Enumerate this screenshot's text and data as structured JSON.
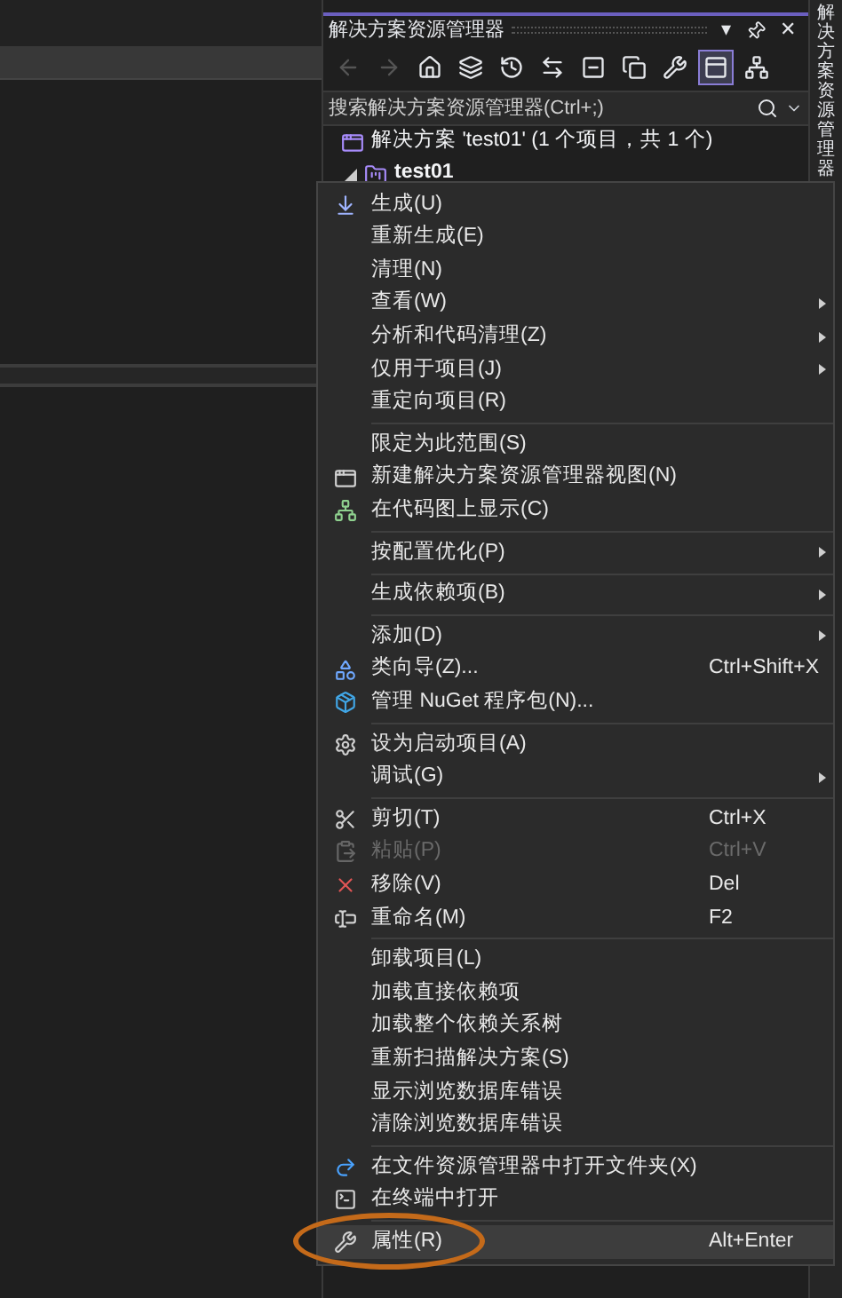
{
  "solution_explorer": {
    "title": "解决方案资源管理器",
    "title_buttons": [
      {
        "kind": "dropdown",
        "label": "▾"
      },
      {
        "kind": "pin"
      },
      {
        "kind": "close",
        "label": "✕"
      }
    ],
    "side_tab": "解决方案资源管理器",
    "toolbar": [
      {
        "kind": "back",
        "disabled": true,
        "selected": false
      },
      {
        "kind": "forward",
        "disabled": true,
        "selected": false
      },
      {
        "kind": "home",
        "disabled": false,
        "selected": false
      },
      {
        "kind": "switch-view",
        "disabled": false,
        "selected": false
      },
      {
        "kind": "history",
        "disabled": false,
        "selected": false
      },
      {
        "kind": "sync",
        "disabled": false,
        "selected": false
      },
      {
        "kind": "collapse",
        "disabled": false,
        "selected": false
      },
      {
        "kind": "copy",
        "disabled": false,
        "selected": false
      },
      {
        "kind": "properties",
        "disabled": false,
        "selected": false
      },
      {
        "kind": "preview",
        "disabled": false,
        "selected": true
      },
      {
        "kind": "diagram",
        "disabled": false,
        "selected": false
      }
    ],
    "search": {
      "placeholder": "搜索解决方案资源管理器(Ctrl+;)"
    },
    "tree": [
      {
        "label": "解决方案 'test01' (1 个项目，共 1 个)",
        "kind": "solution"
      },
      {
        "label": "test01",
        "kind": "project",
        "expanded": true
      }
    ]
  },
  "context_menu": {
    "groups": [
      {
        "items": [
          {
            "label": "生成(U)",
            "kind": "build",
            "submenu": false,
            "disabled": false,
            "highlighted": false,
            "circled": false
          },
          {
            "label": "重新生成(E)",
            "kind": "plain",
            "submenu": false,
            "disabled": false,
            "highlighted": false,
            "circled": false
          },
          {
            "label": "清理(N)",
            "kind": "plain",
            "submenu": false,
            "disabled": false,
            "highlighted": false,
            "circled": false
          },
          {
            "label": "查看(W)",
            "kind": "plain",
            "submenu": true,
            "disabled": false,
            "highlighted": false,
            "circled": false
          },
          {
            "label": "分析和代码清理(Z)",
            "kind": "plain",
            "submenu": true,
            "disabled": false,
            "highlighted": false,
            "circled": false
          },
          {
            "label": "仅用于项目(J)",
            "kind": "plain",
            "submenu": true,
            "disabled": false,
            "highlighted": false,
            "circled": false
          },
          {
            "label": "重定向项目(R)",
            "kind": "plain",
            "submenu": false,
            "disabled": false,
            "highlighted": false,
            "circled": false
          }
        ]
      },
      {
        "items": [
          {
            "label": "限定为此范围(S)",
            "kind": "plain",
            "submenu": false,
            "disabled": false,
            "highlighted": false,
            "circled": false
          },
          {
            "label": "新建解决方案资源管理器视图(N)",
            "kind": "window",
            "submenu": false,
            "disabled": false,
            "highlighted": false,
            "circled": false
          },
          {
            "label": "在代码图上显示(C)",
            "kind": "diagram",
            "submenu": false,
            "disabled": false,
            "highlighted": false,
            "circled": false
          }
        ]
      },
      {
        "items": [
          {
            "label": "按配置优化(P)",
            "kind": "plain",
            "submenu": true,
            "disabled": false,
            "highlighted": false,
            "circled": false
          }
        ]
      },
      {
        "items": [
          {
            "label": "生成依赖项(B)",
            "kind": "plain",
            "submenu": true,
            "disabled": false,
            "highlighted": false,
            "circled": false
          }
        ]
      },
      {
        "items": [
          {
            "label": "添加(D)",
            "kind": "plain",
            "submenu": true,
            "disabled": false,
            "highlighted": false,
            "circled": false
          },
          {
            "label": "类向导(Z)...",
            "kind": "wizard",
            "shortcut": "Ctrl+Shift+X",
            "submenu": false,
            "disabled": false,
            "highlighted": false,
            "circled": false
          },
          {
            "label": "管理 NuGet 程序包(N)...",
            "kind": "package",
            "submenu": false,
            "disabled": false,
            "highlighted": false,
            "circled": false
          }
        ]
      },
      {
        "items": [
          {
            "label": "设为启动项目(A)",
            "kind": "startup",
            "submenu": false,
            "disabled": false,
            "highlighted": false,
            "circled": false
          },
          {
            "label": "调试(G)",
            "kind": "plain",
            "submenu": true,
            "disabled": false,
            "highlighted": false,
            "circled": false
          }
        ]
      },
      {
        "items": [
          {
            "label": "剪切(T)",
            "kind": "cut",
            "shortcut": "Ctrl+X",
            "submenu": false,
            "disabled": false,
            "highlighted": false,
            "circled": false
          },
          {
            "label": "粘贴(P)",
            "kind": "paste",
            "shortcut": "Ctrl+V",
            "submenu": false,
            "disabled": true,
            "highlighted": false,
            "circled": false
          },
          {
            "label": "移除(V)",
            "kind": "remove",
            "shortcut": "Del",
            "submenu": false,
            "disabled": false,
            "highlighted": false,
            "circled": false
          },
          {
            "label": "重命名(M)",
            "kind": "rename",
            "shortcut": "F2",
            "submenu": false,
            "disabled": false,
            "highlighted": false,
            "circled": false
          }
        ]
      },
      {
        "items": [
          {
            "label": "卸载项目(L)",
            "kind": "plain",
            "submenu": false,
            "disabled": false,
            "highlighted": false,
            "circled": false
          },
          {
            "label": "加载直接依赖项",
            "kind": "plain",
            "submenu": false,
            "disabled": false,
            "highlighted": false,
            "circled": false
          },
          {
            "label": "加载整个依赖关系树",
            "kind": "plain",
            "submenu": false,
            "disabled": false,
            "highlighted": false,
            "circled": false
          },
          {
            "label": "重新扫描解决方案(S)",
            "kind": "plain",
            "submenu": false,
            "disabled": false,
            "highlighted": false,
            "circled": false
          },
          {
            "label": "显示浏览数据库错误",
            "kind": "plain",
            "submenu": false,
            "disabled": false,
            "highlighted": false,
            "circled": false
          },
          {
            "label": "清除浏览数据库错误",
            "kind": "plain",
            "submenu": false,
            "disabled": false,
            "highlighted": false,
            "circled": false
          }
        ]
      },
      {
        "items": [
          {
            "label": "在文件资源管理器中打开文件夹(X)",
            "kind": "open-folder",
            "submenu": false,
            "disabled": false,
            "highlighted": false,
            "circled": false
          },
          {
            "label": "在终端中打开",
            "kind": "terminal",
            "submenu": false,
            "disabled": false,
            "highlighted": false,
            "circled": false
          }
        ]
      },
      {
        "items": [
          {
            "label": "属性(R)",
            "kind": "properties",
            "shortcut": "Alt+Enter",
            "submenu": false,
            "disabled": false,
            "highlighted": true,
            "circled": true
          }
        ]
      }
    ]
  }
}
